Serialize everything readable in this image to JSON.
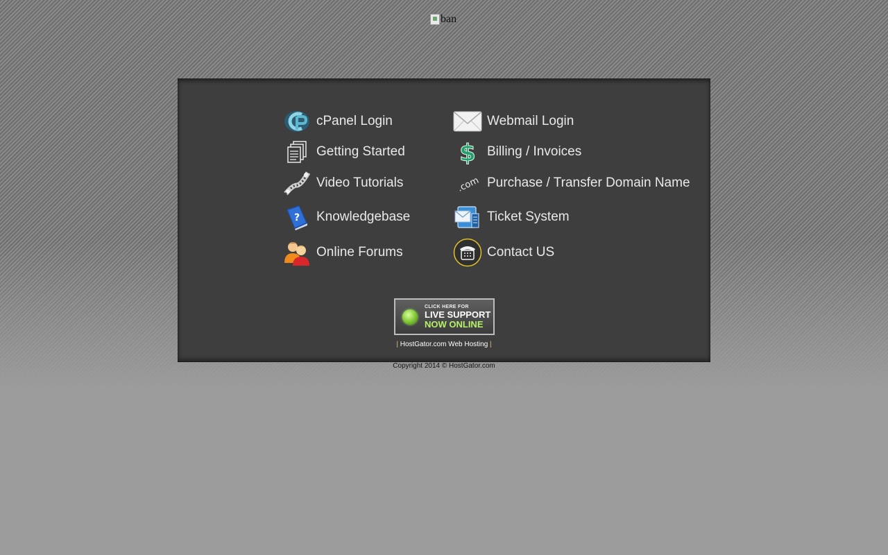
{
  "banner": {
    "alt": "ban"
  },
  "menu": {
    "left": [
      {
        "label": "cPanel Login",
        "icon": "cpanel-icon"
      },
      {
        "label": "Getting Started",
        "icon": "documents-icon"
      },
      {
        "label": "Video Tutorials",
        "icon": "film-strip-icon"
      },
      {
        "label": "Knowledgebase",
        "icon": "help-book-icon"
      },
      {
        "label": "Online Forums",
        "icon": "users-icon"
      }
    ],
    "right": [
      {
        "label": "Webmail Login",
        "icon": "envelope-icon"
      },
      {
        "label": "Billing / Invoices",
        "icon": "dollar-icon"
      },
      {
        "label": "Purchase / Transfer Domain Name",
        "icon": "dotcom-icon"
      },
      {
        "label": "Ticket System",
        "icon": "ticket-icon"
      },
      {
        "label": "Contact US",
        "icon": "phone-icon"
      }
    ]
  },
  "live_support": {
    "line1": "CLICK HERE FOR",
    "line2": "LIVE SUPPORT",
    "line3": "NOW ONLINE"
  },
  "footer": {
    "separator": "|",
    "link": "HostGator.com Web Hosting",
    "copyright": "Copyright 2014 © HostGator.com"
  },
  "colors": {
    "panel": "#3e3e3e",
    "text": "#e9e9e9",
    "accent_green": "#7ec432",
    "phone_ring": "#e3c12a"
  }
}
